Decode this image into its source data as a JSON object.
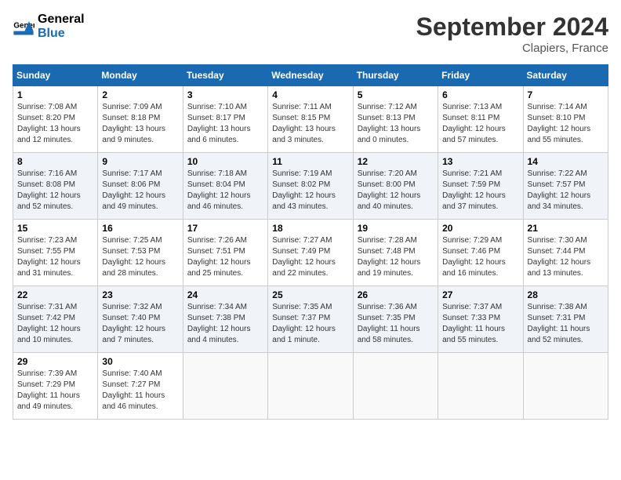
{
  "header": {
    "logo_general": "General",
    "logo_blue": "Blue",
    "month_year": "September 2024",
    "location": "Clapiers, France"
  },
  "days_of_week": [
    "Sunday",
    "Monday",
    "Tuesday",
    "Wednesday",
    "Thursday",
    "Friday",
    "Saturday"
  ],
  "weeks": [
    [
      {
        "day": "1",
        "sunrise": "7:08 AM",
        "sunset": "8:20 PM",
        "daylight": "13 hours and 12 minutes."
      },
      {
        "day": "2",
        "sunrise": "7:09 AM",
        "sunset": "8:18 PM",
        "daylight": "13 hours and 9 minutes."
      },
      {
        "day": "3",
        "sunrise": "7:10 AM",
        "sunset": "8:17 PM",
        "daylight": "13 hours and 6 minutes."
      },
      {
        "day": "4",
        "sunrise": "7:11 AM",
        "sunset": "8:15 PM",
        "daylight": "13 hours and 3 minutes."
      },
      {
        "day": "5",
        "sunrise": "7:12 AM",
        "sunset": "8:13 PM",
        "daylight": "13 hours and 0 minutes."
      },
      {
        "day": "6",
        "sunrise": "7:13 AM",
        "sunset": "8:11 PM",
        "daylight": "12 hours and 57 minutes."
      },
      {
        "day": "7",
        "sunrise": "7:14 AM",
        "sunset": "8:10 PM",
        "daylight": "12 hours and 55 minutes."
      }
    ],
    [
      {
        "day": "8",
        "sunrise": "7:16 AM",
        "sunset": "8:08 PM",
        "daylight": "12 hours and 52 minutes."
      },
      {
        "day": "9",
        "sunrise": "7:17 AM",
        "sunset": "8:06 PM",
        "daylight": "12 hours and 49 minutes."
      },
      {
        "day": "10",
        "sunrise": "7:18 AM",
        "sunset": "8:04 PM",
        "daylight": "12 hours and 46 minutes."
      },
      {
        "day": "11",
        "sunrise": "7:19 AM",
        "sunset": "8:02 PM",
        "daylight": "12 hours and 43 minutes."
      },
      {
        "day": "12",
        "sunrise": "7:20 AM",
        "sunset": "8:00 PM",
        "daylight": "12 hours and 40 minutes."
      },
      {
        "day": "13",
        "sunrise": "7:21 AM",
        "sunset": "7:59 PM",
        "daylight": "12 hours and 37 minutes."
      },
      {
        "day": "14",
        "sunrise": "7:22 AM",
        "sunset": "7:57 PM",
        "daylight": "12 hours and 34 minutes."
      }
    ],
    [
      {
        "day": "15",
        "sunrise": "7:23 AM",
        "sunset": "7:55 PM",
        "daylight": "12 hours and 31 minutes."
      },
      {
        "day": "16",
        "sunrise": "7:25 AM",
        "sunset": "7:53 PM",
        "daylight": "12 hours and 28 minutes."
      },
      {
        "day": "17",
        "sunrise": "7:26 AM",
        "sunset": "7:51 PM",
        "daylight": "12 hours and 25 minutes."
      },
      {
        "day": "18",
        "sunrise": "7:27 AM",
        "sunset": "7:49 PM",
        "daylight": "12 hours and 22 minutes."
      },
      {
        "day": "19",
        "sunrise": "7:28 AM",
        "sunset": "7:48 PM",
        "daylight": "12 hours and 19 minutes."
      },
      {
        "day": "20",
        "sunrise": "7:29 AM",
        "sunset": "7:46 PM",
        "daylight": "12 hours and 16 minutes."
      },
      {
        "day": "21",
        "sunrise": "7:30 AM",
        "sunset": "7:44 PM",
        "daylight": "12 hours and 13 minutes."
      }
    ],
    [
      {
        "day": "22",
        "sunrise": "7:31 AM",
        "sunset": "7:42 PM",
        "daylight": "12 hours and 10 minutes."
      },
      {
        "day": "23",
        "sunrise": "7:32 AM",
        "sunset": "7:40 PM",
        "daylight": "12 hours and 7 minutes."
      },
      {
        "day": "24",
        "sunrise": "7:34 AM",
        "sunset": "7:38 PM",
        "daylight": "12 hours and 4 minutes."
      },
      {
        "day": "25",
        "sunrise": "7:35 AM",
        "sunset": "7:37 PM",
        "daylight": "12 hours and 1 minute."
      },
      {
        "day": "26",
        "sunrise": "7:36 AM",
        "sunset": "7:35 PM",
        "daylight": "11 hours and 58 minutes."
      },
      {
        "day": "27",
        "sunrise": "7:37 AM",
        "sunset": "7:33 PM",
        "daylight": "11 hours and 55 minutes."
      },
      {
        "day": "28",
        "sunrise": "7:38 AM",
        "sunset": "7:31 PM",
        "daylight": "11 hours and 52 minutes."
      }
    ],
    [
      {
        "day": "29",
        "sunrise": "7:39 AM",
        "sunset": "7:29 PM",
        "daylight": "11 hours and 49 minutes."
      },
      {
        "day": "30",
        "sunrise": "7:40 AM",
        "sunset": "7:27 PM",
        "daylight": "11 hours and 46 minutes."
      },
      null,
      null,
      null,
      null,
      null
    ]
  ]
}
